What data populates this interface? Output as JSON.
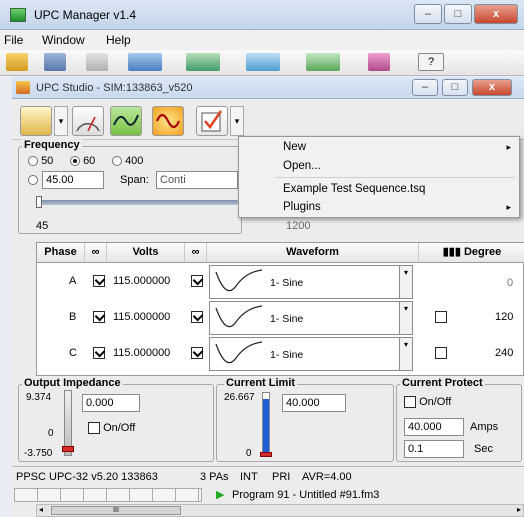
{
  "app": {
    "title": "UPC Manager v1.4"
  },
  "menu": {
    "file": "File",
    "window": "Window",
    "help": "Help"
  },
  "studio": {
    "title": "UPC Studio - SIM:133863_v520"
  },
  "frequency": {
    "label": "Frequency",
    "opt50": "50",
    "opt60": "60",
    "opt400": "400",
    "selected": "60",
    "custom_value": "45.00",
    "span_label": "Span:",
    "span_value": "Conti",
    "slider_min": "45",
    "slider_max": "1200"
  },
  "context_menu": {
    "new": "New",
    "open": "Open...",
    "example": "Example Test Sequence.tsq",
    "plugins": "Plugins"
  },
  "table": {
    "headers": {
      "phase": "Phase",
      "volts": "Volts",
      "waveform": "Waveform",
      "degree": "Degree"
    },
    "rows": [
      {
        "phase": "A",
        "volts": "115.000000",
        "waveform": "1- Sine",
        "degree": "0"
      },
      {
        "phase": "B",
        "volts": "115.000000",
        "waveform": "1- Sine",
        "degree": "120"
      },
      {
        "phase": "C",
        "volts": "115.000000",
        "waveform": "1- Sine",
        "degree": "240"
      }
    ]
  },
  "output_impedance": {
    "label": "Output Impedance",
    "max": "9.374",
    "zero": "0",
    "min": "-3.750",
    "value": "0.000",
    "onoff": "On/Off"
  },
  "current_limit": {
    "label": "Current Limit",
    "max": "26.667",
    "zero": "0",
    "value": "40.000",
    "fill_fraction": 0.9
  },
  "current_protect": {
    "label": "Current Protect",
    "onoff": "On/Off",
    "amps_value": "40.000",
    "amps_unit": "Amps",
    "sec_value": "0.1",
    "sec_unit": "Sec"
  },
  "status": {
    "device": "PPSC UPC-32 v5.20 133863",
    "pas": "3 PAs",
    "int": "INT",
    "pri": "PRI",
    "avr": "AVR=4.00",
    "program": "Program 91 - Untitled #91.fm3"
  },
  "scroll": {
    "thumb": "III"
  },
  "colors": {
    "accent_green": "#22aa22",
    "slider_blue": "#1f5fd6",
    "slider_red": "#d52a2a",
    "close_red": "#c9472d"
  }
}
